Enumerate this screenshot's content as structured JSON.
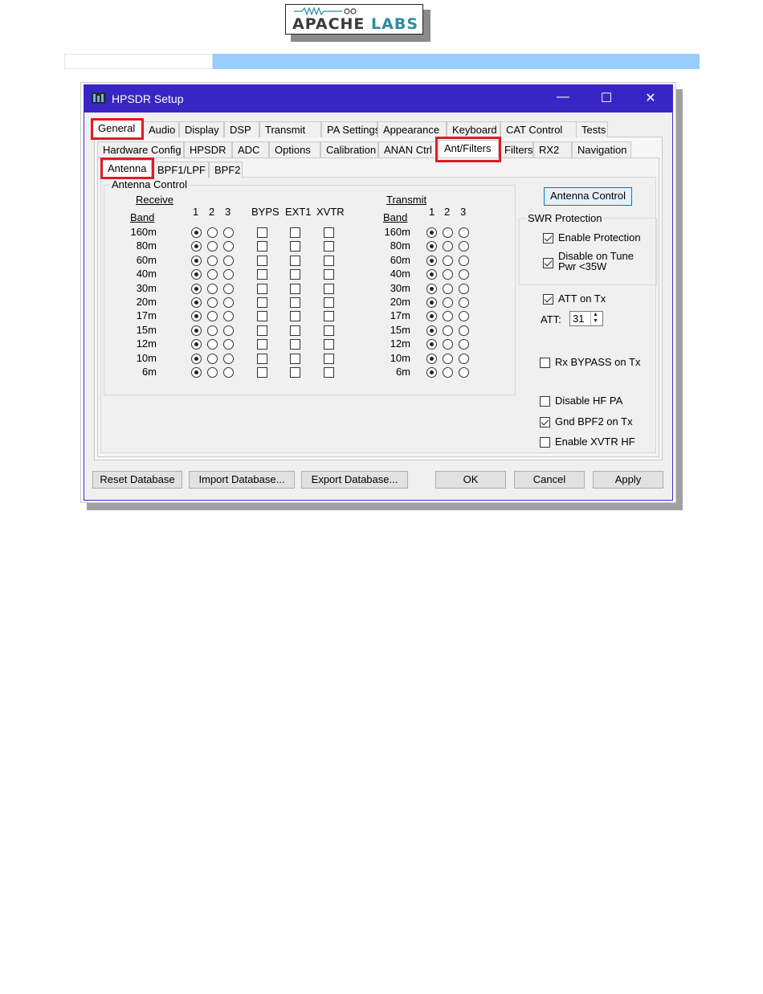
{
  "logo": {
    "part1": "APACHE",
    "part2": "LABS"
  },
  "colors": {
    "titlebar": "#3826c4",
    "highlight": "#e01b24",
    "band": "#99ccff",
    "logo_accent": "#2f8aa0"
  },
  "window": {
    "title": "HPSDR Setup",
    "minimize": "—",
    "maximize": "☐",
    "close": "✕"
  },
  "tabs_row1": [
    "General",
    "Audio",
    "Display",
    "DSP",
    "Transmit",
    "PA Settings",
    "Appearance",
    "Keyboard",
    "CAT Control",
    "Tests"
  ],
  "tabs_row2": [
    "Hardware Config",
    "HPSDR",
    "ADC",
    "Options",
    "Calibration",
    "ANAN Ctrl",
    "Ant/Filters",
    "Filters",
    "RX2",
    "Navigation"
  ],
  "tabs_row3": [
    "Antenna",
    "BPF1/LPF",
    "BPF2"
  ],
  "antenna_control": {
    "group_title": "Antenna Control",
    "receive_label": "Receive",
    "transmit_label": "Transmit",
    "band_label": "Band",
    "ant_numbers": [
      "1",
      "2",
      "3"
    ],
    "extras": [
      "BYPS",
      "EXT1",
      "XVTR"
    ],
    "bands": [
      "160m",
      "80m",
      "60m",
      "40m",
      "30m",
      "20m",
      "17m",
      "15m",
      "12m",
      "10m",
      "6m"
    ]
  },
  "right": {
    "antenna_control_button": "Antenna Control",
    "swr_title": "SWR Protection",
    "enable_protection": "Enable Protection",
    "disable_tune_1": "Disable on Tune",
    "disable_tune_2": "Pwr <35W",
    "att_on_tx": "ATT on Tx",
    "att_label": "ATT:",
    "att_value": "31",
    "rx_bypass": "Rx BYPASS on Tx",
    "disable_hf_pa": "Disable HF PA",
    "gnd_bpf2": "Gnd BPF2 on Tx",
    "enable_xvtr_hf": "Enable XVTR HF"
  },
  "bottom": {
    "reset": "Reset Database",
    "import": "Import Database...",
    "export": "Export Database...",
    "ok": "OK",
    "cancel": "Cancel",
    "apply": "Apply"
  }
}
